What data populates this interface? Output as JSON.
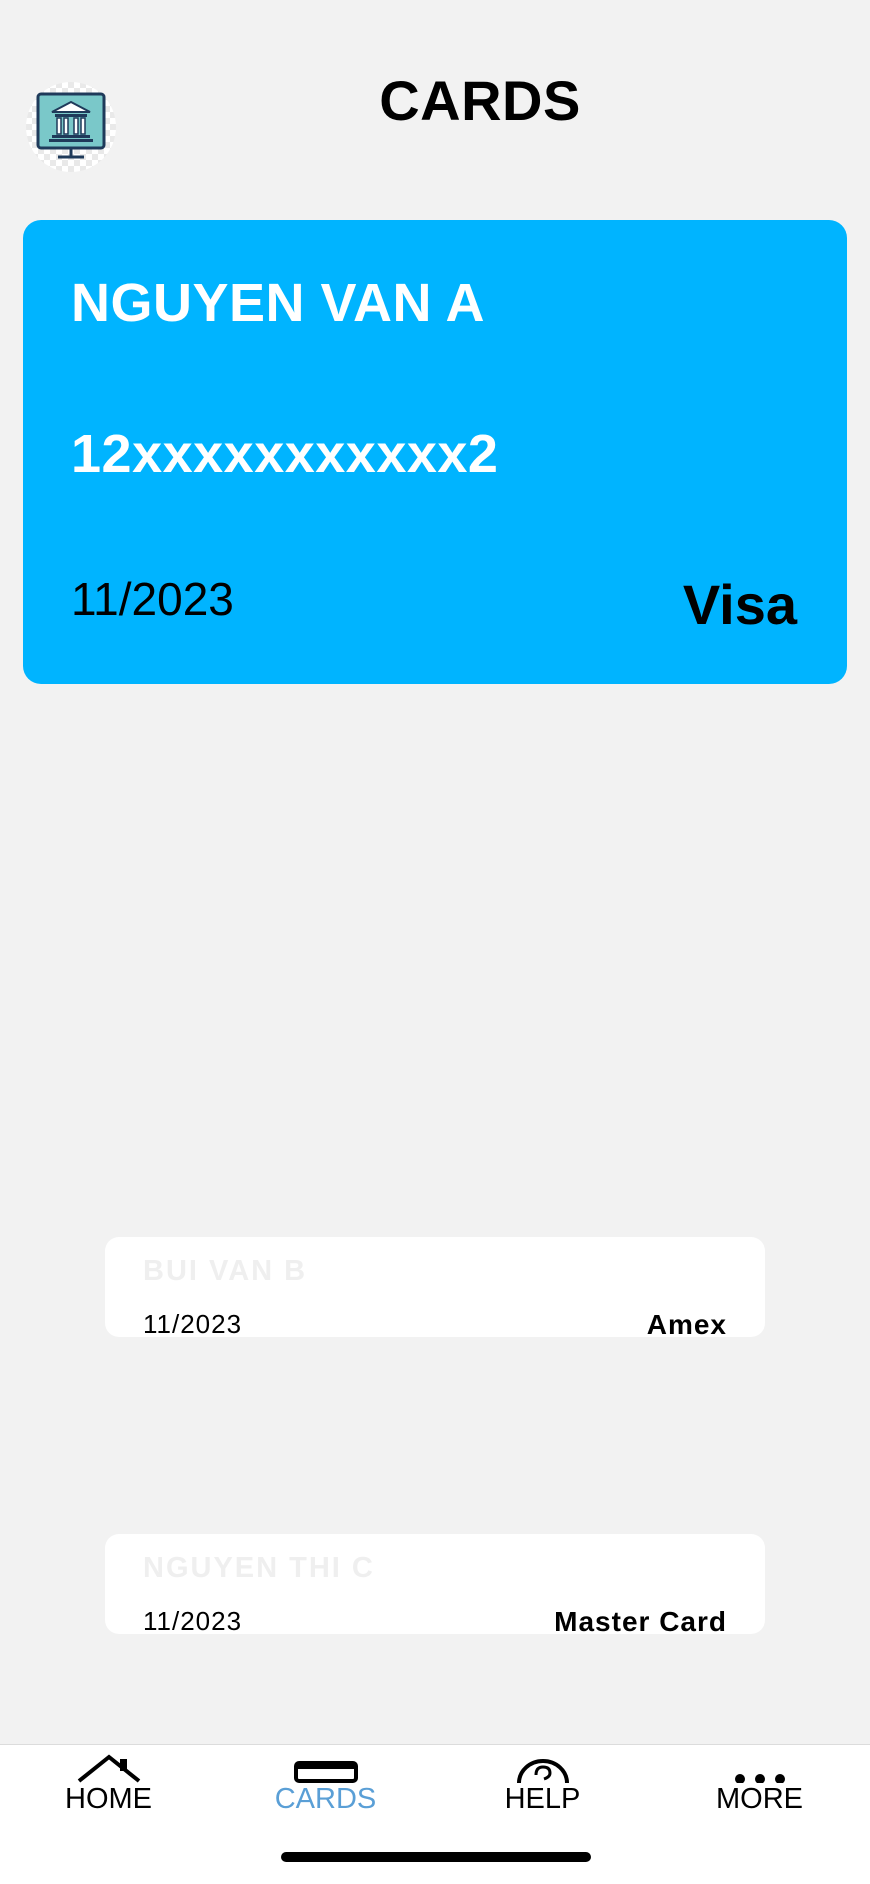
{
  "header": {
    "title": "CARDS",
    "logo_icon": "bank-icon"
  },
  "cards": [
    {
      "holder": "NGUYEN VAN A",
      "number": "12xxxxxxxxxxx2",
      "expiry": "11/2023",
      "brand": "Visa",
      "color": "#00b4ff"
    },
    {
      "holder": "BUI VAN B",
      "expiry": "11/2023",
      "brand": "Amex",
      "color": "#ffffff"
    },
    {
      "holder": "NGUYEN THI C",
      "expiry": "11/2023",
      "brand": "Master Card",
      "color": "#ffffff"
    }
  ],
  "tabbar": {
    "items": [
      {
        "label": "HOME",
        "icon": "home-icon",
        "active": false
      },
      {
        "label": "CARDS",
        "icon": "bed-icon",
        "active": true
      },
      {
        "label": "HELP",
        "icon": "help-icon",
        "active": false
      },
      {
        "label": "MORE",
        "icon": "more-icon",
        "active": false
      }
    ],
    "active_color": "#5a9fd6"
  }
}
